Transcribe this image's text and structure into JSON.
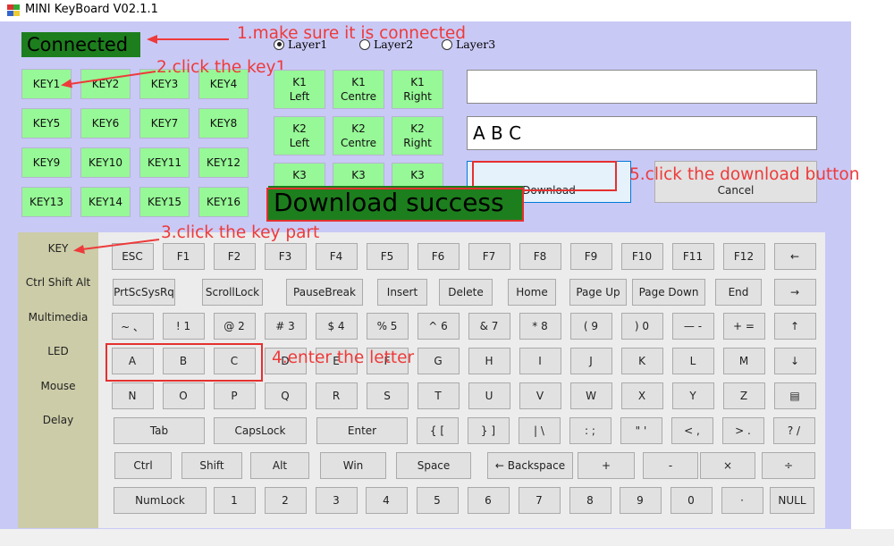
{
  "window": {
    "title": "MINI KeyBoard V02.1.1"
  },
  "status": {
    "connected": "Connected",
    "success": "Download success"
  },
  "annotations": {
    "a1": "1.make sure it is connected",
    "a2": "2.click the key1",
    "a3": "3.click the key part",
    "a4": "4.enter the letter",
    "a5": "5.click the download button"
  },
  "layers": [
    {
      "label": "Layer1",
      "selected": true
    },
    {
      "label": "Layer2",
      "selected": false
    },
    {
      "label": "Layer3",
      "selected": false
    }
  ],
  "key_grid": [
    "KEY1",
    "KEY2",
    "KEY3",
    "KEY4",
    "KEY5",
    "KEY6",
    "KEY7",
    "KEY8",
    "KEY9",
    "KEY10",
    "KEY11",
    "KEY12",
    "KEY13",
    "KEY14",
    "KEY15",
    "KEY16"
  ],
  "knobs": [
    [
      "K1\nLeft",
      "K1\nCentre",
      "K1\nRight"
    ],
    [
      "K2\nLeft",
      "K2\nCentre",
      "K2\nRight"
    ],
    [
      "K3",
      "K3",
      "K3"
    ]
  ],
  "inputs": {
    "top_value": "",
    "main_value": "A B C"
  },
  "buttons": {
    "download": "Download",
    "cancel": "Cancel"
  },
  "sidebar": [
    "KEY",
    "Ctrl Shift Alt",
    "Multimedia",
    "LED",
    "Mouse",
    "Delay"
  ],
  "keyboard_rows": [
    [
      "ESC",
      "F1",
      "F2",
      "F3",
      "F4",
      "F5",
      "F6",
      "F7",
      "F8",
      "F9",
      "F10",
      "F11",
      "F12",
      "←"
    ],
    [
      "PrtScSysRq",
      "ScrollLock",
      "PauseBreak",
      "Insert",
      "Delete",
      "Home",
      "Page Up",
      "Page Down",
      "End",
      "→"
    ],
    [
      "~ 、",
      "! 1",
      "@ 2",
      "# 3",
      "$ 4",
      "% 5",
      "^ 6",
      "& 7",
      "* 8",
      "( 9",
      ") 0",
      "— -",
      "+ =",
      "↑"
    ],
    [
      "A",
      "B",
      "C",
      "D",
      "E",
      "F",
      "G",
      "H",
      "I",
      "J",
      "K",
      "L",
      "M",
      "↓"
    ],
    [
      "N",
      "O",
      "P",
      "Q",
      "R",
      "S",
      "T",
      "U",
      "V",
      "W",
      "X",
      "Y",
      "Z",
      "▤"
    ],
    [
      "Tab",
      "CapsLock",
      "Enter",
      "{ [",
      "} ]",
      "| \\",
      ": ;",
      "\" '",
      "< ,",
      "> .",
      "? /"
    ],
    [
      "Ctrl",
      "Shift",
      "Alt",
      "Win",
      "Space",
      "← Backspace",
      "+",
      "-",
      "×",
      "÷"
    ],
    [
      "NumLock",
      "1",
      "2",
      "3",
      "4",
      "5",
      "6",
      "7",
      "8",
      "9",
      "0",
      "·",
      "NULL"
    ]
  ]
}
